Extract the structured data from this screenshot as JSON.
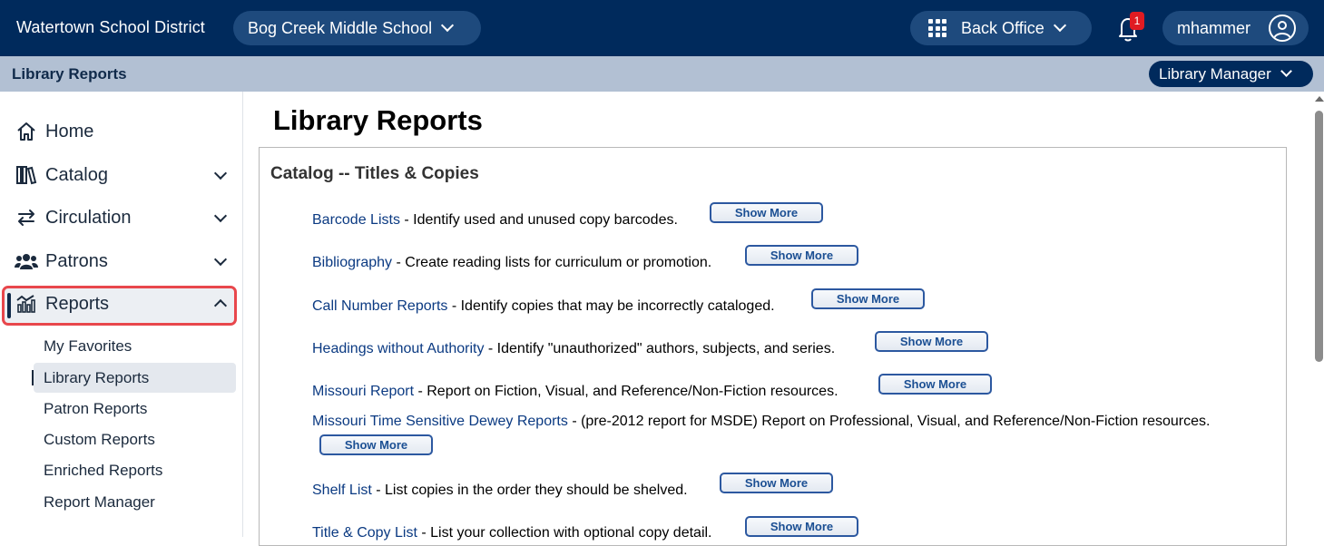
{
  "topbar": {
    "district": "Watertown School District",
    "school": "Bog Creek Middle School",
    "back_office": "Back Office",
    "notification_count": "1",
    "username": "mhammer"
  },
  "subbar": {
    "title": "Library Reports",
    "role": "Library Manager"
  },
  "sidebar": {
    "items": [
      {
        "label": "Home",
        "icon": "home-icon",
        "expandable": false
      },
      {
        "label": "Catalog",
        "icon": "books-icon",
        "expandable": true
      },
      {
        "label": "Circulation",
        "icon": "arrows-icon",
        "expandable": true
      },
      {
        "label": "Patrons",
        "icon": "people-icon",
        "expandable": true
      },
      {
        "label": "Reports",
        "icon": "chart-icon",
        "expandable": true,
        "expanded": true
      }
    ],
    "report_subitems": [
      {
        "label": "My Favorites"
      },
      {
        "label": "Library Reports",
        "active": true
      },
      {
        "label": "Patron Reports"
      },
      {
        "label": "Custom Reports"
      },
      {
        "label": "Enriched Reports"
      },
      {
        "label": "Report Manager"
      }
    ]
  },
  "main": {
    "title": "Library Reports",
    "section_title": "Catalog -- Titles & Copies",
    "show_more_label": "Show More",
    "reports": [
      {
        "name": "Barcode Lists",
        "desc": " - Identify used and unused copy barcodes."
      },
      {
        "name": "Bibliography",
        "desc": " - Create reading lists for curriculum or promotion."
      },
      {
        "name": "Call Number Reports",
        "desc": " - Identify copies that may be incorrectly cataloged."
      },
      {
        "name": "Headings without Authority",
        "desc": " - Identify \"unauthorized\" authors, subjects, and series."
      },
      {
        "name": "Missouri Report",
        "desc": " - Report on Fiction, Visual, and Reference/Non-Fiction resources."
      },
      {
        "name": "Missouri Time Sensitive Dewey Reports",
        "desc": " - (pre-2012 report for MSDE) Report on Professional, Visual, and Reference/Non-Fiction resources."
      },
      {
        "name": "Shelf List",
        "desc": " - List copies in the order they should be shelved."
      },
      {
        "name": "Title & Copy List",
        "desc": " - List your collection with optional copy detail."
      }
    ]
  },
  "colors": {
    "topbar": "#002a5c",
    "subbar": "#b2c0d3",
    "highlight_border": "#e8474c",
    "link": "#0b3a82"
  }
}
